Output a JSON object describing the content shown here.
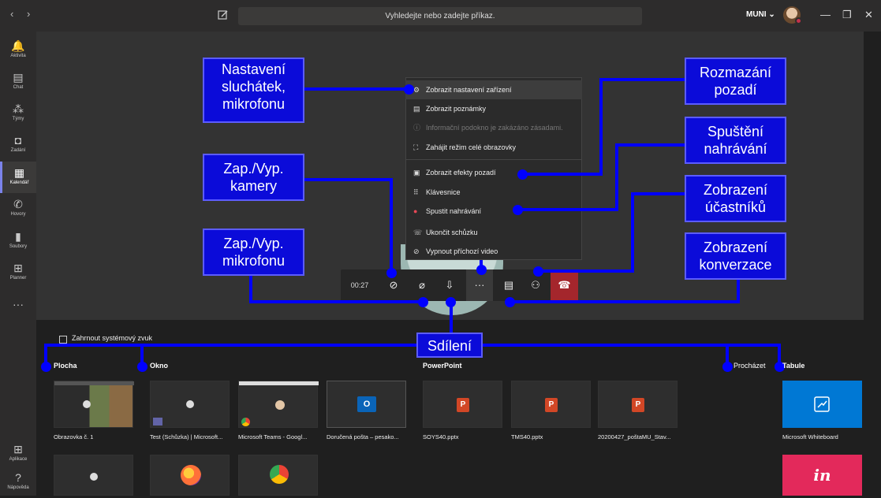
{
  "topbar": {
    "back": "‹",
    "forward": "›",
    "search_placeholder": "Vyhledejte nebo zadejte příkaz.",
    "org": "MUNI ⌄",
    "minimize": "—",
    "maximize": "❐",
    "close": "✕"
  },
  "rail": {
    "items": [
      {
        "icon": "bell-icon",
        "glyph": "🔔",
        "label": "Aktivita"
      },
      {
        "icon": "chat-icon",
        "glyph": "▤",
        "label": "Chat"
      },
      {
        "icon": "teams-icon",
        "glyph": "⁂",
        "label": "Týmy"
      },
      {
        "icon": "assignments-icon",
        "glyph": "◘",
        "label": "Zadání"
      },
      {
        "icon": "calendar-icon",
        "glyph": "▦",
        "label": "Kalendář"
      },
      {
        "icon": "phone-icon",
        "glyph": "✆",
        "label": "Hovory"
      },
      {
        "icon": "files-icon",
        "glyph": "▮",
        "label": "Soubory"
      },
      {
        "icon": "planner-icon",
        "glyph": "⊞",
        "label": "Planner"
      }
    ],
    "more": "···",
    "apps": {
      "glyph": "⊞",
      "label": "Aplikace"
    },
    "help": {
      "glyph": "?",
      "label": "Nápověda"
    }
  },
  "toolbar": {
    "timer": "00:27",
    "camera": "⊘",
    "mic": "⌀",
    "share": "⇩",
    "more": "···",
    "chat": "▤",
    "people": "⚇",
    "hangup": "☎"
  },
  "menu": {
    "items": [
      {
        "icon": "⚙",
        "label": "Zobrazit nastavení zařízení",
        "disabled": false
      },
      {
        "icon": "▤",
        "label": "Zobrazit poznámky",
        "disabled": false
      },
      {
        "icon": "ⓘ",
        "label": "Informační podokno je zakázáno zásadami.",
        "disabled": true
      },
      {
        "icon": "⛶",
        "label": "Zahájit režim celé obrazovky",
        "disabled": false
      },
      {
        "icon": "▣",
        "label": "Zobrazit efekty pozadí",
        "disabled": false
      },
      {
        "icon": "⠿",
        "label": "Klávesnice",
        "disabled": false
      },
      {
        "icon": "●",
        "label": "Spustit nahrávání",
        "disabled": false
      },
      {
        "icon": "☏",
        "label": "Ukončit schůzku",
        "disabled": false
      },
      {
        "icon": "⊘",
        "label": "Vypnout příchozí video",
        "disabled": false
      }
    ]
  },
  "callouts": {
    "headset": [
      "Nastavení",
      "sluchátek,",
      "mikrofonu"
    ],
    "camera": [
      "Zap./Vyp.",
      "kamery"
    ],
    "mic": [
      "Zap./Vyp.",
      "mikrofonu"
    ],
    "blur": [
      "Rozmazání",
      "pozadí"
    ],
    "record": [
      "Spuštění",
      "nahrávání"
    ],
    "participants": [
      "Zobrazení",
      "účastníků"
    ],
    "conversation": [
      "Zobrazení",
      "konverzace"
    ],
    "sharing": "Sdílení"
  },
  "share": {
    "system_audio": "Zahrnout systémový zvuk",
    "sections": {
      "desktop": "Plocha",
      "window": "Okno",
      "powerpoint": "PowerPoint",
      "browse": "Procházet",
      "whiteboard": "Tabule"
    },
    "captions": [
      "Obrazovka č. 1",
      "Test (Schůzka) | Microsoft...",
      "Microsoft Teams - Googl...",
      "Doručená pošta – pesako...",
      "SOYS40.pptx",
      "TMS40.pptx",
      "20200427_poštaMU_Stav...",
      "Microsoft Whiteboard"
    ],
    "ppt_letter": "P",
    "outlook_letter": "O",
    "invision": "in"
  },
  "colors": {
    "callout_bg": "#0b0bd9",
    "connector": "#0000ff",
    "hangup": "#a4262c",
    "whiteboard": "#0078d4",
    "invision": "#e3295b",
    "accent": "#7b83eb"
  }
}
